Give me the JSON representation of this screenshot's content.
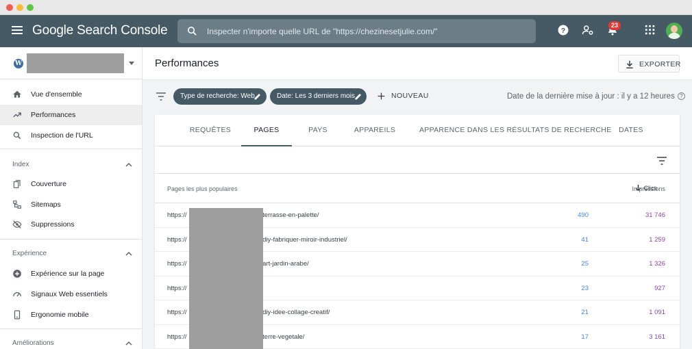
{
  "window": {
    "dots": [
      "#ee5d56",
      "#f6bd3d",
      "#5ec846"
    ]
  },
  "header": {
    "logo": "Google Search Console",
    "search_placeholder": "Inspecter n'importe quelle URL de \"https://chezinesetjulie.com/\"",
    "notifications_count": "23"
  },
  "sidebar": {
    "property_icon": "W",
    "main_items": [
      {
        "label": "Vue d'ensemble",
        "icon": "home-icon"
      },
      {
        "label": "Performances",
        "icon": "trending-up-icon",
        "active": true
      },
      {
        "label": "Inspection de l'URL",
        "icon": "search-icon"
      }
    ],
    "sections": [
      {
        "title": "Index",
        "items": [
          {
            "label": "Couverture",
            "icon": "copy-icon"
          },
          {
            "label": "Sitemaps",
            "icon": "sitemap-icon"
          },
          {
            "label": "Suppressions",
            "icon": "visibility-off-icon"
          }
        ]
      },
      {
        "title": "Expérience",
        "items": [
          {
            "label": "Expérience sur la page",
            "icon": "add-circle-icon"
          },
          {
            "label": "Signaux Web essentiels",
            "icon": "speed-icon"
          },
          {
            "label": "Ergonomie mobile",
            "icon": "phone-icon"
          }
        ]
      },
      {
        "title": "Améliorations",
        "items": []
      }
    ]
  },
  "main": {
    "title": "Performances",
    "export_label": "EXPORTER",
    "filters": {
      "chip1": "Type de recherche: Web",
      "chip2": "Date: Les 3 derniers mois",
      "new_label": "NOUVEAU",
      "updated": "Date de la dernière mise à jour : il y a 12 heures",
      "help": "?"
    },
    "tabs": [
      "REQUÊTES",
      "PAGES",
      "PAYS",
      "APPAREILS",
      "APPARENCE DANS LES RÉSULTATS DE RECHERCHE",
      "DATES"
    ],
    "active_tab": "PAGES",
    "table": {
      "col_pages": "Pages les plus populaires",
      "col_clicks": "Clics",
      "col_impressions": "Impressions",
      "rows": [
        {
          "prefix": "https://",
          "suffix": "/terrasse-en-palette/",
          "clicks": "490",
          "impressions": "31 746"
        },
        {
          "prefix": "https://",
          "suffix": "/diy-fabriquer-miroir-industriel/",
          "clicks": "41",
          "impressions": "1 259"
        },
        {
          "prefix": "https://",
          "suffix": "/art-jardin-arabe/",
          "clicks": "25",
          "impressions": "1 326"
        },
        {
          "prefix": "https://",
          "suffix": "",
          "clicks": "23",
          "impressions": "927"
        },
        {
          "prefix": "https://",
          "suffix": "/diy-idee-collage-creatif/",
          "clicks": "21",
          "impressions": "1 091"
        },
        {
          "prefix": "https://",
          "suffix": "/terre-vegetale/",
          "clicks": "17",
          "impressions": "3 161"
        }
      ]
    }
  }
}
